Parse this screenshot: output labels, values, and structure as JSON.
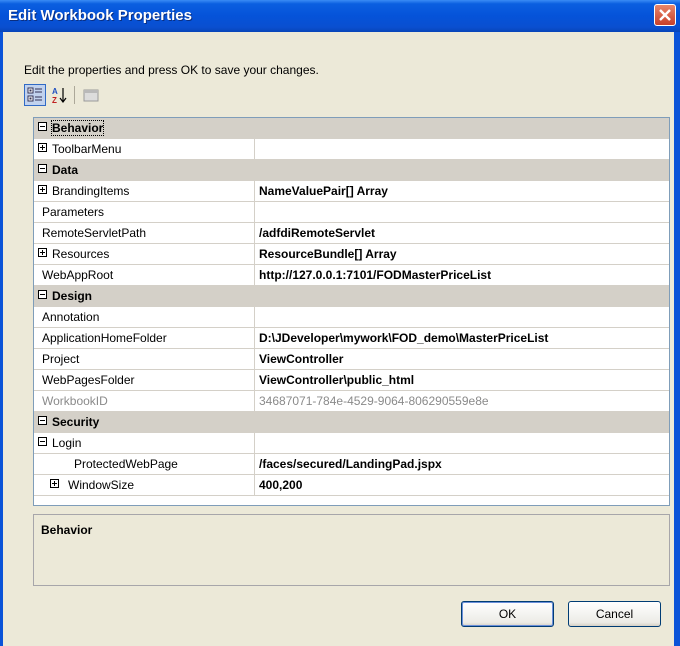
{
  "window": {
    "title": "Edit Workbook Properties"
  },
  "instructions": "Edit the properties and press OK to save your changes.",
  "toolbar": {
    "categorized_icon": "categorized-icon",
    "alphabetical_icon": "alphabetical-sort-icon",
    "pages_icon": "property-pages-icon"
  },
  "grid": {
    "rows": [
      {
        "type": "category",
        "name": "Behavior"
      },
      {
        "type": "property",
        "name": "ToolbarMenu",
        "value": "",
        "expander": "plus"
      },
      {
        "type": "category",
        "name": "Data"
      },
      {
        "type": "property",
        "name": "BrandingItems",
        "value": "NameValuePair[] Array",
        "expander": "plus"
      },
      {
        "type": "property",
        "name": "Parameters",
        "value": ""
      },
      {
        "type": "property",
        "name": "RemoteServletPath",
        "value": "/adfdiRemoteServlet"
      },
      {
        "type": "property",
        "name": "Resources",
        "value": "ResourceBundle[] Array",
        "expander": "plus"
      },
      {
        "type": "property",
        "name": "WebAppRoot",
        "value": "http://127.0.0.1:7101/FODMasterPriceList"
      },
      {
        "type": "category",
        "name": "Design"
      },
      {
        "type": "property",
        "name": "Annotation",
        "value": ""
      },
      {
        "type": "property",
        "name": "ApplicationHomeFolder",
        "value": "D:\\JDeveloper\\mywork\\FOD_demo\\MasterPriceList"
      },
      {
        "type": "property",
        "name": "Project",
        "value": "ViewController"
      },
      {
        "type": "property",
        "name": "WebPagesFolder",
        "value": "ViewController\\public_html"
      },
      {
        "type": "property",
        "name": "WorkbookID",
        "value": "34687071-784e-4529-9064-806290559e8e",
        "readonly": true
      },
      {
        "type": "category",
        "name": "Security"
      },
      {
        "type": "property",
        "name": "Login",
        "value": "",
        "expander": "minus"
      },
      {
        "type": "property",
        "name": "ProtectedWebPage",
        "value": "/faces/secured/LandingPad.jspx",
        "indent": 2
      },
      {
        "type": "property",
        "name": "WindowSize",
        "value": "400,200",
        "expander": "plus",
        "indent": 1
      }
    ]
  },
  "description": {
    "title": "Behavior"
  },
  "buttons": {
    "ok": "OK",
    "cancel": "Cancel"
  }
}
